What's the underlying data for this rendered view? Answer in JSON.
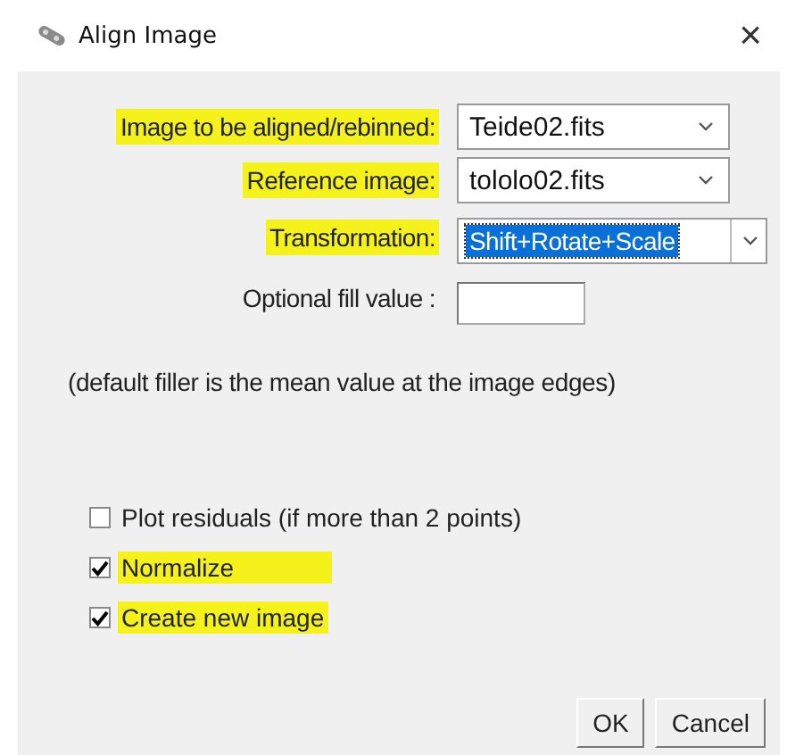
{
  "window": {
    "title": "Align Image",
    "close": "×"
  },
  "fields": [
    {
      "kind": "dropdown",
      "label": "Image to be aligned/rebinned:",
      "highlighted": true,
      "value": "Teide02.fits",
      "focused": false
    },
    {
      "kind": "dropdown",
      "label": "Reference image:",
      "highlighted": true,
      "value": "tololo02.fits",
      "focused": false
    },
    {
      "kind": "dropdown",
      "label": "Transformation:",
      "highlighted": true,
      "value": "Shift+Rotate+Scale",
      "focused": true
    },
    {
      "kind": "text",
      "label": "Optional fill value :",
      "highlighted": false
    }
  ],
  "note": "(default filler is the mean value at the image edges)",
  "checkboxes": [
    {
      "label": "Plot residuals (if more than 2 points)",
      "checked": false,
      "highlighted": false
    },
    {
      "label": "Normalize",
      "checked": true,
      "highlighted": true
    },
    {
      "label": "Create new image",
      "checked": true,
      "highlighted": true
    }
  ],
  "buttons": [
    "OK",
    "Cancel"
  ]
}
